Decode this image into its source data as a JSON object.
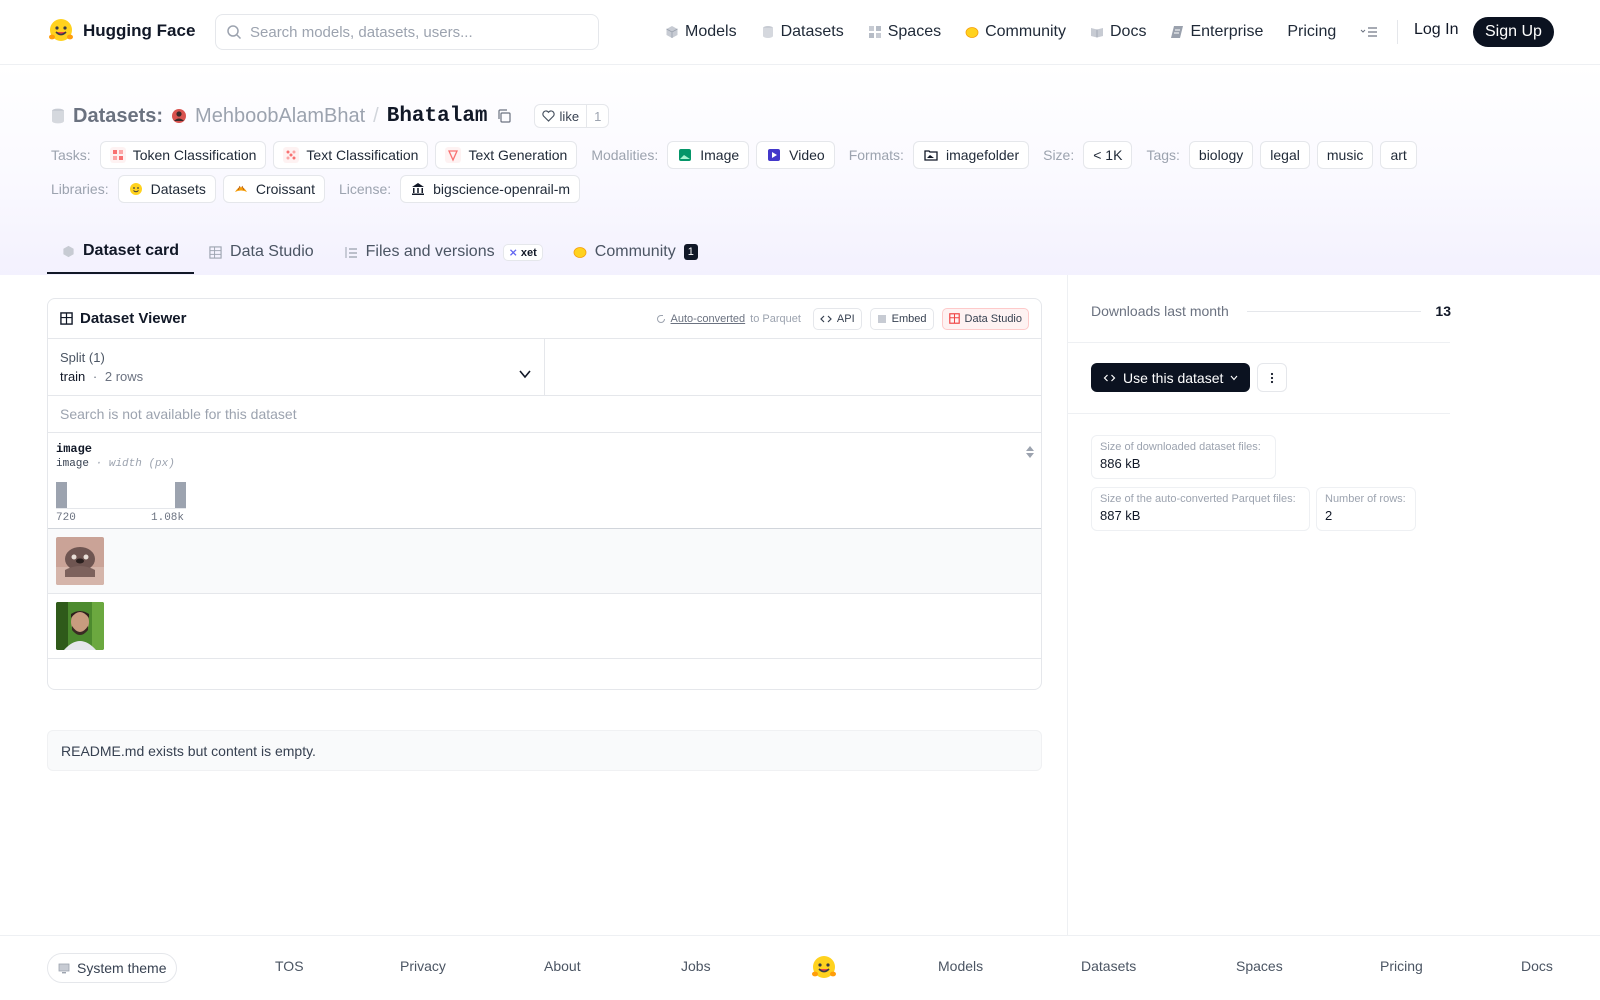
{
  "header": {
    "brand": "Hugging Face",
    "search_placeholder": "Search models, datasets, users...",
    "nav": [
      "Models",
      "Datasets",
      "Spaces",
      "Community",
      "Docs",
      "Enterprise",
      "Pricing"
    ],
    "login": "Log In",
    "signup": "Sign Up"
  },
  "repo": {
    "kind": "Datasets:",
    "owner": "MehboobAlamBhat",
    "slash": "/",
    "name": "Bhatalam",
    "like_label": "like",
    "like_count": "1"
  },
  "tags": {
    "tasks_label": "Tasks:",
    "tasks": [
      "Token Classification",
      "Text Classification",
      "Text Generation"
    ],
    "modalities_label": "Modalities:",
    "modalities": [
      "Image",
      "Video"
    ],
    "formats_label": "Formats:",
    "formats": [
      "imagefolder"
    ],
    "size_label": "Size:",
    "size": "< 1K",
    "tags_label": "Tags:",
    "tags": [
      "biology",
      "legal",
      "music",
      "art"
    ],
    "libraries_label": "Libraries:",
    "libraries": [
      "Datasets",
      "Croissant"
    ],
    "license_label": "License:",
    "license": "bigscience-openrail-m"
  },
  "tabs": {
    "dataset_card": "Dataset card",
    "data_studio": "Data Studio",
    "files": "Files and versions",
    "xet": "xet",
    "community": "Community",
    "community_count": "1"
  },
  "viewer": {
    "title": "Dataset Viewer",
    "autoconv_link": "Auto-converted",
    "autoconv_rest": "to Parquet",
    "api": "API",
    "embed": "Embed",
    "data_studio": "Data Studio",
    "split_label": "Split (1)",
    "split_name": "train",
    "split_dot": "·",
    "split_rows": "2 rows",
    "search_na": "Search is not available for this dataset",
    "column": {
      "name": "image",
      "type": "image",
      "type_sep": "·",
      "type_detail": "width (px)",
      "hist_min": "720",
      "hist_max": "1.08k",
      "hist_values": [
        1,
        1
      ]
    }
  },
  "readme": "README.md exists but content is empty.",
  "sidebar": {
    "downloads_label": "Downloads last month",
    "downloads": "13",
    "use_button": "Use this dataset",
    "stats": [
      {
        "label": "Size of downloaded dataset files:",
        "value": "886 kB"
      },
      {
        "label": "Size of the auto-converted Parquet files:",
        "value": "887 kB"
      },
      {
        "label": "Number of rows:",
        "value": "2"
      }
    ]
  },
  "footer": {
    "theme": "System theme",
    "links": [
      "TOS",
      "Privacy",
      "About",
      "Jobs",
      "Models",
      "Datasets",
      "Spaces",
      "Pricing",
      "Docs"
    ]
  },
  "colors": {
    "accent_dark": "#0b1220",
    "hero_tint": "#f3f1fe",
    "hf_yellow": "#ffd21e"
  }
}
